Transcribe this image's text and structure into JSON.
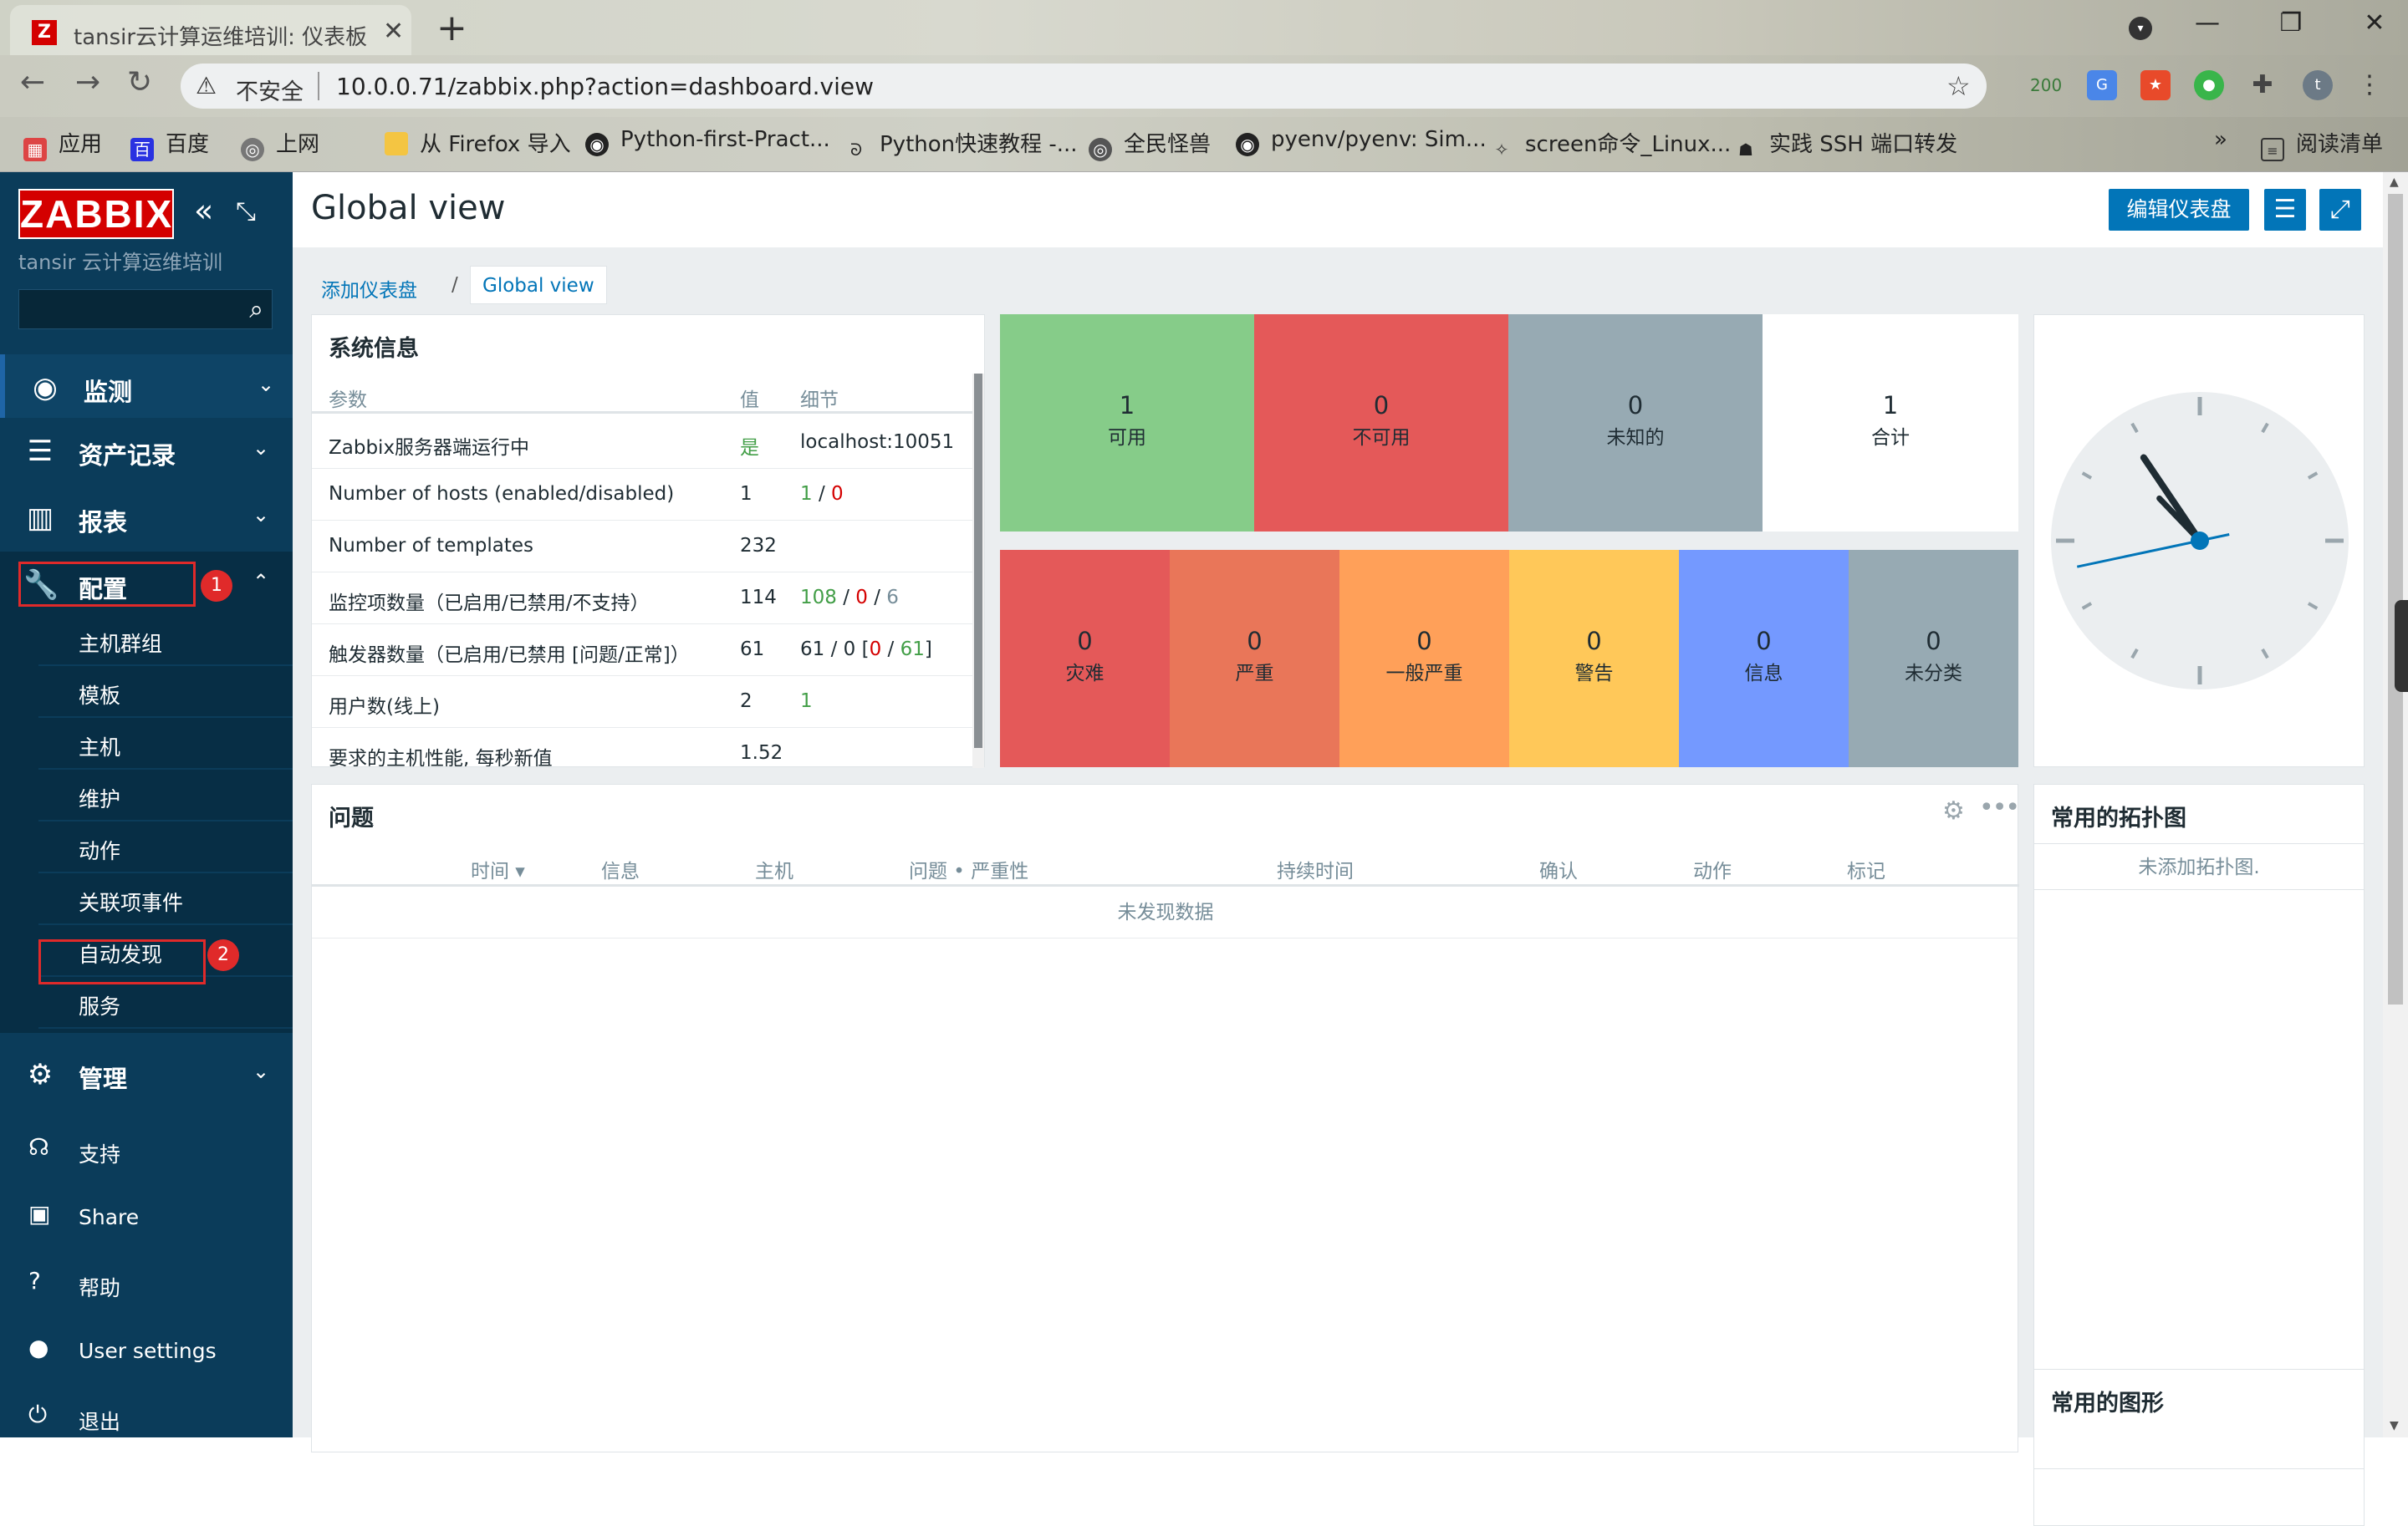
{
  "browser": {
    "tab_title": "tansir云计算运维培训: 仪表板",
    "window_controls": [
      "—",
      "❐",
      "✕"
    ],
    "address": {
      "security_label": "不安全",
      "url": "10.0.0.71/zabbix.php?action=dashboard.view"
    },
    "extension_count": "200",
    "profile_initial": "t",
    "bookmarks": [
      {
        "icon": "apps-icon",
        "label": "应用"
      },
      {
        "icon": "baidu-icon",
        "label": "百度"
      },
      {
        "icon": "globe-icon",
        "label": "上网"
      },
      {
        "icon": "folder-icon",
        "label": "从 Firefox 导入"
      },
      {
        "icon": "github-icon",
        "label": "Python-first-Pract..."
      },
      {
        "icon": "python-icon",
        "label": "Python快速教程 -..."
      },
      {
        "icon": "globe-icon",
        "label": "全民怪兽"
      },
      {
        "icon": "github-icon",
        "label": "pyenv/pyenv: Sim..."
      },
      {
        "icon": "site-icon",
        "label": "screen命令_Linux..."
      },
      {
        "icon": "ssh-icon",
        "label": "实践 SSH 端口转发"
      }
    ],
    "bookmarks_overflow": "»",
    "reading_list": "阅读清单"
  },
  "sidebar": {
    "logo": "ZABBIX",
    "server_name": "tansir 云计算运维培训",
    "search_placeholder": "",
    "menu": {
      "monitor": "监测",
      "inventory": "资产记录",
      "reports": "报表",
      "config": "配置",
      "admin": "管理"
    },
    "config_items": [
      "主机群组",
      "模板",
      "主机",
      "维护",
      "动作",
      "关联项事件",
      "自动发现",
      "服务"
    ],
    "footer": {
      "support": "支持",
      "share": "Share",
      "help": "帮助",
      "user_settings": "User settings",
      "logout": "退出"
    },
    "annotations": {
      "badge1": "1",
      "badge2": "2"
    }
  },
  "header": {
    "title": "Global view",
    "edit_button": "编辑仪表盘"
  },
  "breadcrumb": {
    "parent": "添加仪表盘",
    "separator": "/",
    "current": "Global view"
  },
  "system_info": {
    "title": "系统信息",
    "columns": [
      "参数",
      "值",
      "细节"
    ],
    "rows": [
      {
        "param": "Zabbix服务器端运行中",
        "value": "是",
        "detail": "localhost:10051"
      },
      {
        "param": "Number of hosts (enabled/disabled)",
        "value": "1",
        "detail_a": "1",
        "detail_sep": " / ",
        "detail_b": "0"
      },
      {
        "param": "Number of templates",
        "value": "232",
        "detail": ""
      },
      {
        "param": "监控项数量（已启用/已禁用/不支持）",
        "value": "114",
        "detail_a": "108",
        "detail_b": "0",
        "detail_c": "6"
      },
      {
        "param": "触发器数量（已启用/已禁用 [问题/正常]）",
        "value": "61",
        "detail_pre": "61 / 0 [",
        "detail_a": "0",
        "detail_b": "61",
        "detail_post": "]"
      },
      {
        "param": "用户数(线上)",
        "value": "2",
        "detail": "1"
      },
      {
        "param": "要求的主机性能, 每秒新值",
        "value": "1.52",
        "detail": ""
      }
    ]
  },
  "host_availability": [
    {
      "count": "1",
      "label": "可用",
      "color": "#86cc89"
    },
    {
      "count": "0",
      "label": "不可用",
      "color": "#e45959"
    },
    {
      "count": "0",
      "label": "未知的",
      "color": "#97aab3"
    },
    {
      "count": "1",
      "label": "合计",
      "color": "#ffffff"
    }
  ],
  "problems_by_severity": [
    {
      "count": "0",
      "label": "灾难",
      "color": "#e45959"
    },
    {
      "count": "0",
      "label": "严重",
      "color": "#e97659"
    },
    {
      "count": "0",
      "label": "一般严重",
      "color": "#ffa059"
    },
    {
      "count": "0",
      "label": "警告",
      "color": "#ffc859"
    },
    {
      "count": "0",
      "label": "信息",
      "color": "#7499ff"
    },
    {
      "count": "0",
      "label": "未分类",
      "color": "#97aab3"
    }
  ],
  "clock": {
    "hour": 10,
    "minute": 52,
    "second": 43
  },
  "problems": {
    "title": "问题",
    "columns": [
      "时间 ▾",
      "信息",
      "主机",
      "问题 • 严重性",
      "持续时间",
      "确认",
      "动作",
      "标记"
    ],
    "empty": "未发现数据"
  },
  "favorite_maps": {
    "title": "常用的拓扑图",
    "empty": "未添加拓扑图."
  },
  "favorite_graphs": {
    "title": "常用的图形"
  },
  "colors": {
    "sidebar_bg": "#0b3c5a",
    "accent": "#0275b8",
    "annotation_red": "#e02a2a"
  }
}
